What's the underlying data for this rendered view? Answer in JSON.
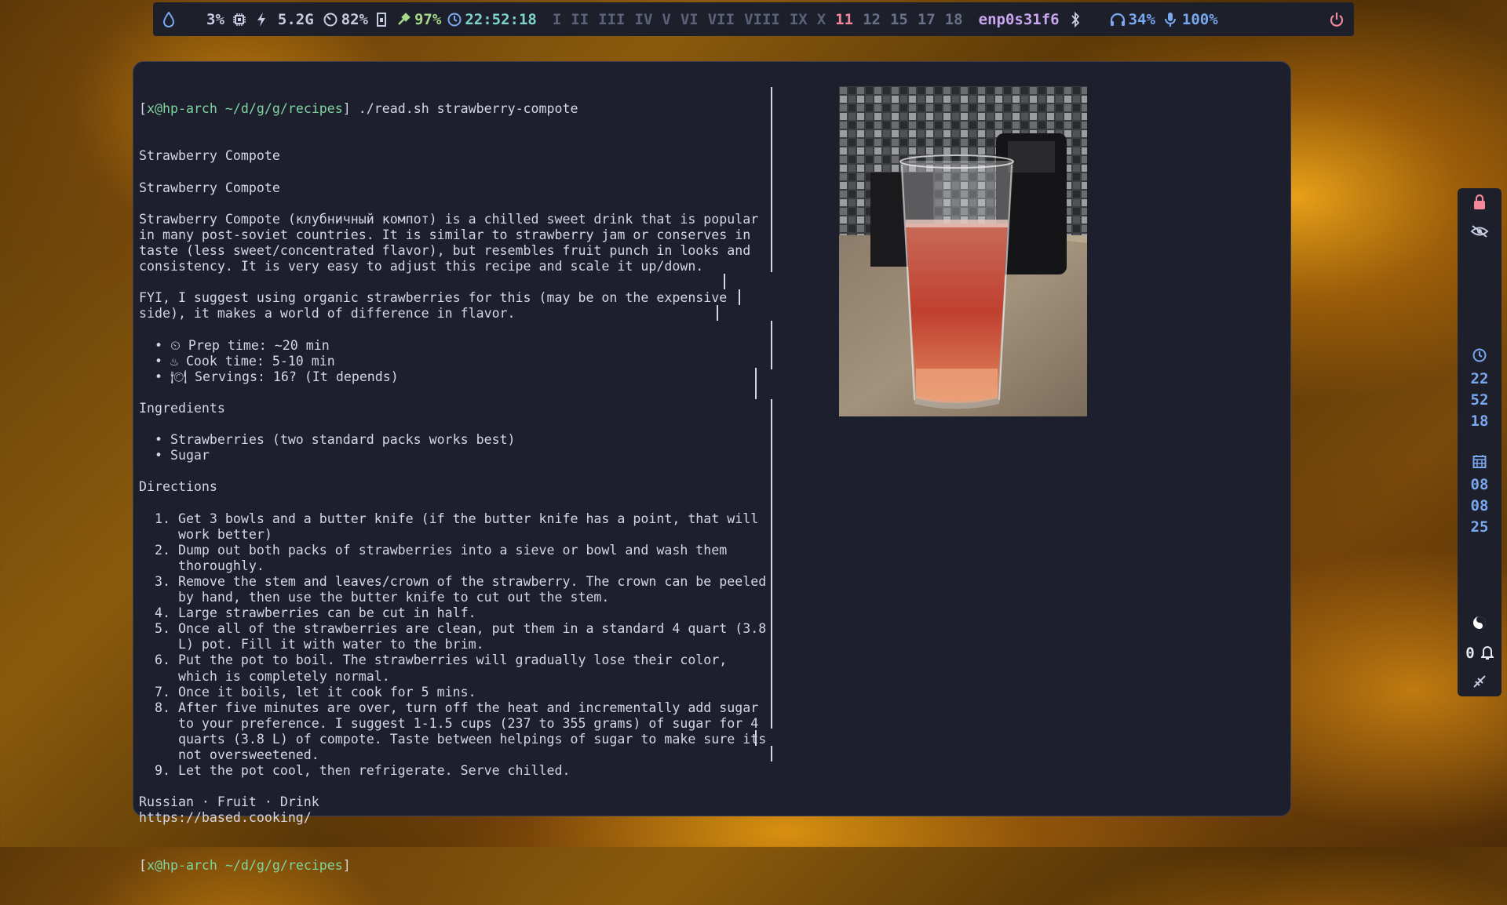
{
  "topbar": {
    "cpu": "3%",
    "power": "5.2G",
    "disk": "82%",
    "battery": "97%",
    "clock": "22:52:18",
    "workspaces": [
      "I",
      "II",
      "III",
      "IV",
      "V",
      "VI",
      "VII",
      "VIII",
      "IX",
      "X",
      "11",
      "12",
      "15",
      "17",
      "18"
    ],
    "active_workspace": "11",
    "network": "enp0s31f6",
    "headphone_volume": "34%",
    "mic_volume": "100%",
    "colors": {
      "accent": "#7aa8f0",
      "active": "#f2889a",
      "network": "#c9a6f0",
      "battery": "#a6d98a",
      "bar_bg": "#1d1f2b"
    }
  },
  "terminal": {
    "prompt_user": "x@hp-arch",
    "prompt_path": "~/d/g/g/recipes",
    "command": "./read.sh strawberry-compote",
    "lines": [
      "Strawberry Compote",
      "",
      "Strawberry Compote",
      "",
      "Strawberry Compote (клубничный компот) is a chilled sweet drink that is popular",
      "in many post-soviet countries. It is similar to strawberry jam or conserves in",
      "taste (less sweet/concentrated flavor), but resembles fruit punch in looks and",
      "consistency. It is very easy to adjust this recipe and scale it up/down.",
      "",
      "FYI, I suggest using organic strawberries for this (may be on the expensive",
      "side), it makes a world of difference in flavor.",
      "",
      "  • ⏲ Prep time: ~20 min",
      "  • ♨ Cook time: 5-10 min",
      "  • 🍽 Servings: 16? (It depends)",
      "",
      "Ingredients",
      "",
      "  • Strawberries (two standard packs works best)",
      "  • Sugar",
      "",
      "Directions",
      "",
      "  1. Get 3 bowls and a butter knife (if the butter knife has a point, that will",
      "     work better)",
      "  2. Dump out both packs of strawberries into a sieve or bowl and wash them",
      "     thoroughly.",
      "  3. Remove the stem and leaves/crown of the strawberry. The crown can be peeled",
      "     by hand, then use the butter knife to cut out the stem.",
      "  4. Large strawberries can be cut in half.",
      "  5. Once all of the strawberries are clean, put them in a standard 4 quart (3.8",
      "     L) pot. Fill it with water to the brim.",
      "  6. Put the pot to boil. The strawberries will gradually lose their color,",
      "     which is completely normal.",
      "  7. Once it boils, let it cook for 5 mins.",
      "  8. After five minutes are over, turn off the heat and incrementally add sugar",
      "     to your preference. I suggest 1-1.5 cups (237 to 355 grams) of sugar for 4",
      "     quarts (3.8 L) of compote. Taste between helpings of sugar to make sure its",
      "     not oversweetened.",
      "  9. Let the pot cool, then refrigerate. Serve chilled.",
      "",
      "Russian · Fruit · Drink",
      "https://based.cooking/"
    ]
  },
  "sidebar": {
    "time": [
      "22",
      "52",
      "18"
    ],
    "date": [
      "08",
      "08",
      "25"
    ],
    "notification_count": "0",
    "colors": {
      "text": "#7aa8f0",
      "lock": "#f2889a"
    }
  }
}
